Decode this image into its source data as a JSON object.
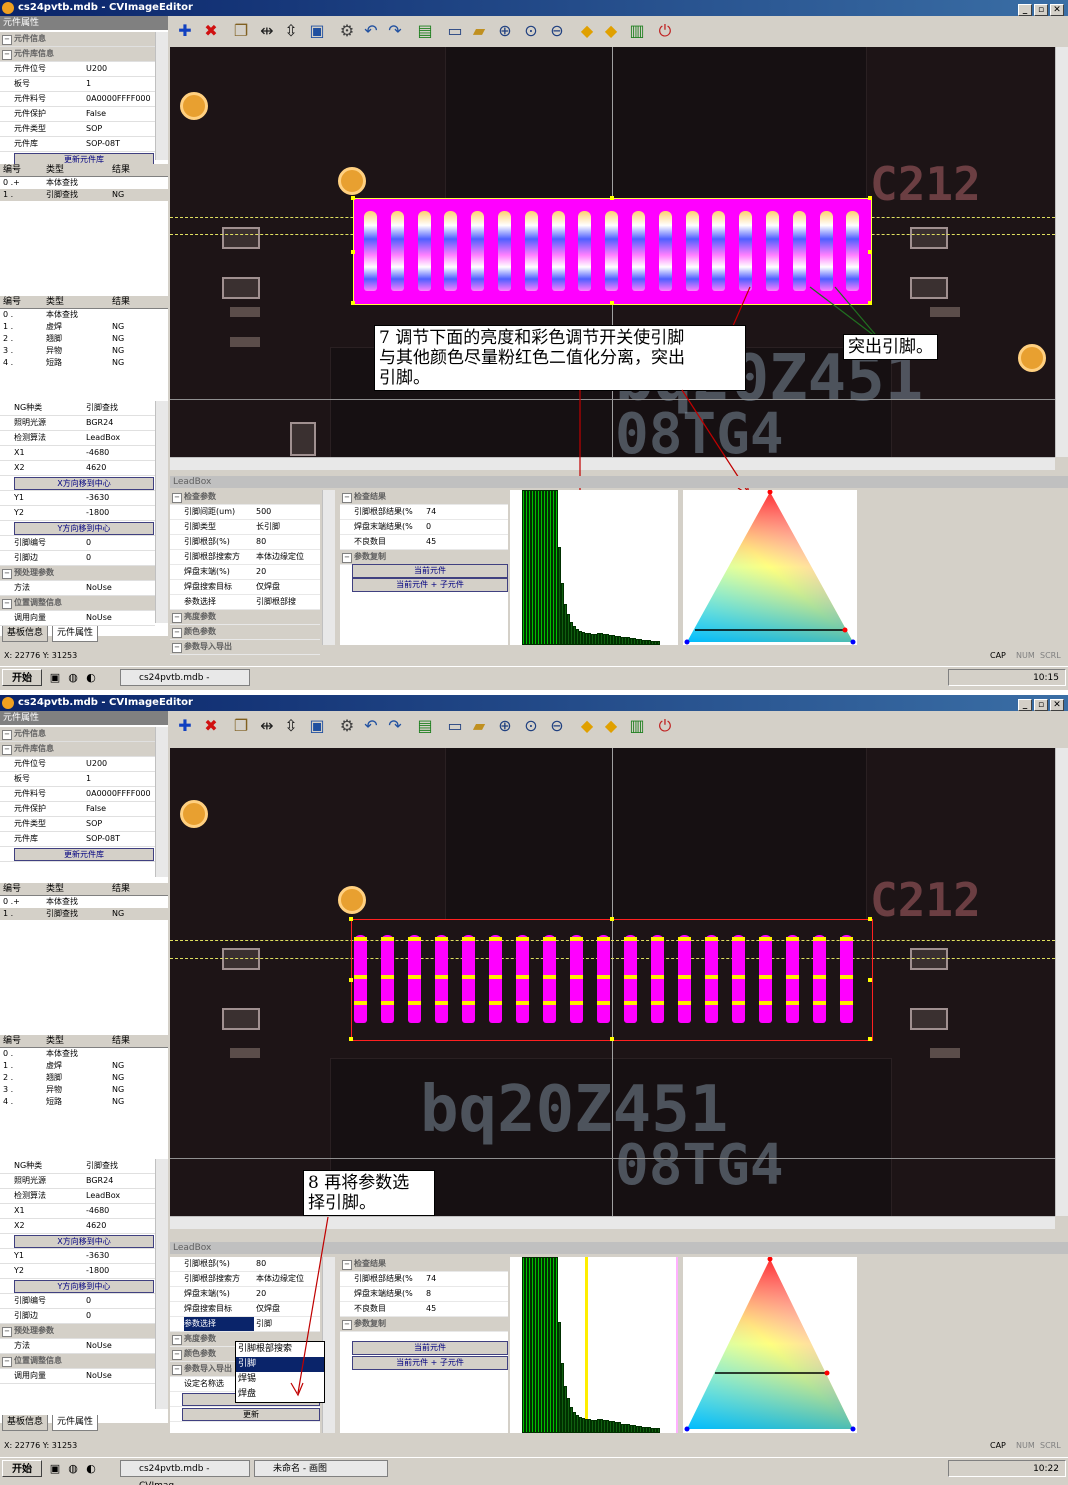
{
  "window_title": "cs24pvtb.mdb - CVImageEditor",
  "left": {
    "panel_title": "元件属性",
    "props": [
      {
        "k": "元件信息",
        "sec": true
      },
      {
        "k": "元件库信息",
        "sec": true
      },
      {
        "k": "元件位号",
        "v": "U200"
      },
      {
        "k": "板号",
        "v": "1"
      },
      {
        "k": "元件料号",
        "v": "0A0000FFFF000"
      },
      {
        "k": "元件保护",
        "v": "False"
      },
      {
        "k": "元件类型",
        "v": "SOP"
      },
      {
        "k": "元件库",
        "v": "SOP-08T"
      },
      {
        "k": "更新元件库",
        "btn": true
      }
    ],
    "table1": {
      "headers": [
        "编号",
        "类型",
        "结果"
      ],
      "rows": [
        [
          "0 .+",
          "本体查找",
          ""
        ],
        [
          "1 .",
          "引脚查找",
          "NG"
        ]
      ]
    },
    "table2": {
      "headers": [
        "编号",
        "类型",
        "结果"
      ],
      "rows": [
        [
          "0 .",
          "本体查找",
          ""
        ],
        [
          "1 .",
          "虚焊",
          "NG"
        ],
        [
          "2 .",
          "翘脚",
          "NG"
        ],
        [
          "3 .",
          "异物",
          "NG"
        ],
        [
          "4 .",
          "短路",
          "NG"
        ]
      ]
    },
    "ng_props": [
      {
        "k": "NG种类",
        "v": "引脚查找"
      },
      {
        "k": "照明光源",
        "v": "BGR24"
      },
      {
        "k": "检测算法",
        "v": "LeadBox"
      },
      {
        "k": "X1",
        "v": "-4680"
      },
      {
        "k": "X2",
        "v": "4620"
      },
      {
        "k": "X方向移到中心",
        "btn": true
      },
      {
        "k": "Y1",
        "v": "-3630"
      },
      {
        "k": "Y2",
        "v": "-1800"
      },
      {
        "k": "Y方向移到中心",
        "btn": true
      },
      {
        "k": "引脚编号",
        "v": "0"
      },
      {
        "k": "引脚边",
        "v": "0"
      },
      {
        "k": "预处理参数",
        "sec": true
      },
      {
        "k": "方法",
        "v": "NoUse"
      },
      {
        "k": "位置调整信息",
        "sec": true
      },
      {
        "k": "调用向量",
        "v": "NoUse"
      }
    ],
    "tabs": [
      "基板信息",
      "元件属性"
    ]
  },
  "lb_title": "LeadBox",
  "shot1": {
    "params": [
      {
        "k": "检查参数",
        "sec": true
      },
      {
        "k": "引脚间距(um)",
        "v": "500"
      },
      {
        "k": "引脚类型",
        "v": "长引脚"
      },
      {
        "k": "引脚根部(%)",
        "v": "80"
      },
      {
        "k": "引脚根部搜索方",
        "v": "本体边缘定位"
      },
      {
        "k": "焊盘末端(%)",
        "v": "20"
      },
      {
        "k": "焊盘搜索目标",
        "v": "仅焊盘"
      },
      {
        "k": "参数选择",
        "v": "引脚根部搜"
      },
      {
        "k": "亮度参数",
        "sec": true
      },
      {
        "k": "颜色参数",
        "sec": true
      },
      {
        "k": "参数导入导出",
        "sec": true
      }
    ],
    "callout_main": "7 调节下面的亮度和彩色调节开关使引脚\n与其他颜色尽量粉红色二值化分离，突出\n引脚。",
    "callout_side": "突出引脚。",
    "silk_main": "bq20Z451",
    "silk_sub": "08TG4",
    "silk_right": "C212",
    "status_xy": "X: 22776 Y: 31253",
    "clock": "10:15",
    "task_items": [
      "cs24pvtb.mdb - CVImag..."
    ]
  },
  "shot2": {
    "params": [
      {
        "k": "引脚根部(%)",
        "v": "80"
      },
      {
        "k": "引脚根部搜索方",
        "v": "本体边缘定位"
      },
      {
        "k": "焊盘末端(%)",
        "v": "20"
      },
      {
        "k": "焊盘搜索目标",
        "v": "仅焊盘"
      },
      {
        "k": "参数选择",
        "v": "引脚",
        "hl": true
      },
      {
        "k": "亮度参数",
        "sec": true
      },
      {
        "k": "颜色参数",
        "sec": true
      },
      {
        "k": "参数导入导出",
        "sec": true
      },
      {
        "k": "设定名称选",
        "v": ""
      },
      {
        "k": "导入",
        "btn": true
      },
      {
        "k": "更新",
        "btn": true
      }
    ],
    "dropdown": [
      "引脚根部搜索",
      "引脚",
      "焊锡",
      "焊盘"
    ],
    "dropdown_selected": 1,
    "callout_main": "8 再将参数选\n择引脚。",
    "silk_main": "bq20Z451",
    "silk_sub": "08TG4",
    "silk_right": "C212",
    "status_xy": "X: 22776 Y: 31253",
    "clock": "10:22",
    "task_items": [
      "cs24pvtb.mdb - CVImag...",
      "未命名 - 画图"
    ]
  },
  "results": [
    {
      "k": "检查结果",
      "sec": true
    },
    {
      "k": "引脚根部结果(%",
      "v": "74"
    },
    {
      "k": "焊盘末端结果(%",
      "v": "0"
    },
    {
      "k": "不良数目",
      "v": "45"
    },
    {
      "k": "参数复制",
      "sec": true
    }
  ],
  "results2_end_value": "8",
  "copy_buttons": [
    "当前元件",
    "当前元件 + 子元件"
  ],
  "histogram": {
    "bins": [
      0,
      0,
      0,
      0,
      150,
      150,
      150,
      150,
      150,
      150,
      150,
      150,
      150,
      150,
      150,
      150,
      95,
      60,
      40,
      30,
      22,
      18,
      15,
      14,
      13,
      12,
      12,
      11,
      11,
      12,
      12,
      11,
      11,
      10,
      10,
      9,
      9,
      8,
      8,
      8,
      7,
      7,
      6,
      6,
      5,
      5,
      5,
      4,
      4,
      4
    ]
  },
  "status_indicators": [
    "CAP",
    "NUM",
    "SCRL"
  ],
  "start_label": "开始",
  "toolbar_icons": [
    "add-icon",
    "delete-icon",
    "copy-icon",
    "fit-width-icon",
    "fit-height-icon",
    "select-icon",
    "settings-icon",
    "undo-icon",
    "redo-icon",
    "book-icon",
    "save-icon",
    "open-folder-icon",
    "zoom-in-icon",
    "zoom-fit-icon",
    "zoom-out-icon",
    "arrow-left-icon",
    "arrow-right-icon",
    "export-icon",
    "power-icon"
  ]
}
